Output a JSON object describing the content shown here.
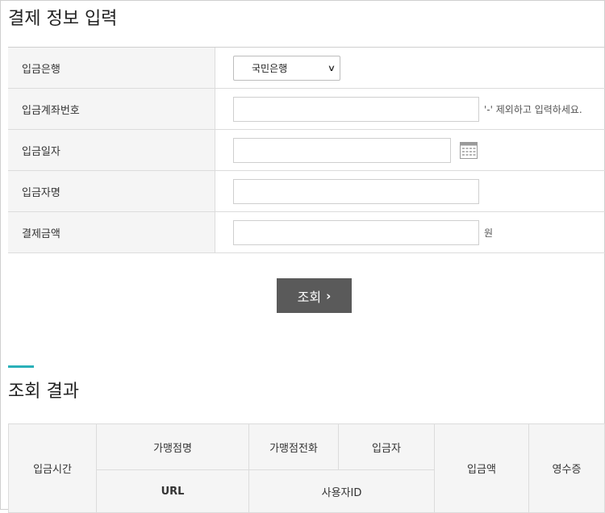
{
  "payment_section": {
    "title": "결제 정보 입력",
    "fields": {
      "bank": {
        "label": "입금은행",
        "selected": "국민은행"
      },
      "account": {
        "label": "입금계좌번호",
        "value": "",
        "hint": "'-' 제외하고 입력하세요."
      },
      "date": {
        "label": "입금일자",
        "value": ""
      },
      "depositor": {
        "label": "입금자명",
        "value": ""
      },
      "amount": {
        "label": "결제금액",
        "value": "",
        "unit": "원"
      }
    },
    "search_button": {
      "label": "조회",
      "icon": "chevron-right-icon"
    }
  },
  "result_section": {
    "title": "조회 결과",
    "accent_color": "#2ab0b8",
    "columns": {
      "deposit_time": "입금시간",
      "merchant_name": "가맹점명",
      "merchant_phone": "가맹점전화",
      "depositor": "입금자",
      "url": "URL",
      "user_id": "사용자ID",
      "deposit_amount": "입금액",
      "receipt": "영수증"
    }
  }
}
